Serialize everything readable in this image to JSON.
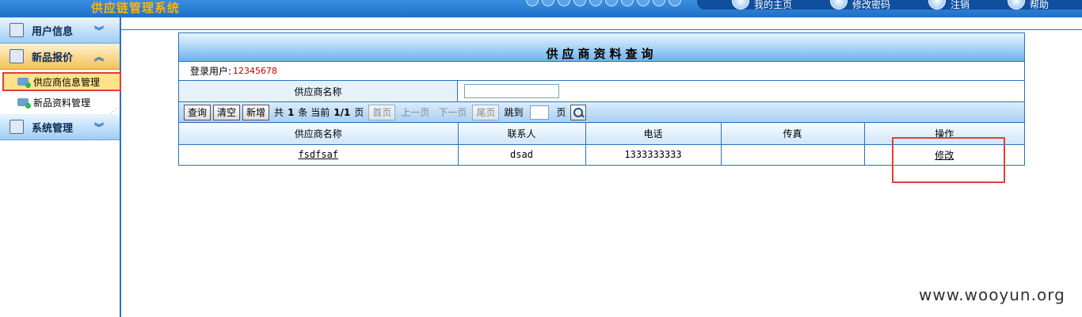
{
  "header": {
    "app_title": "供应链管理系统",
    "toolbar": [
      "我的主页",
      "修改密码",
      "注销",
      "帮助"
    ]
  },
  "sidebar": {
    "groups": [
      {
        "label": "用户信息",
        "expanded": false
      },
      {
        "label": "新品报价",
        "expanded": true,
        "items": [
          "供应商信息管理",
          "新品资料管理"
        ]
      },
      {
        "label": "系统管理",
        "expanded": false
      }
    ]
  },
  "panel": {
    "title": "供应商资料查询",
    "user_label": "登录用户:",
    "user_id": "12345678",
    "filter_label": "供应商名称",
    "filter_value": "",
    "buttons": {
      "query": "查询",
      "clear": "清空",
      "add": "新增"
    },
    "pager": {
      "total_prefix": "共",
      "total": "1",
      "total_suffix": "条",
      "current_prefix": "当前",
      "current": "1/1",
      "current_suffix": "页",
      "first": "首页",
      "prev": "上一页",
      "next": "下一页",
      "last": "尾页",
      "jump_label": "跳到",
      "jump_suffix": "页"
    },
    "columns": [
      "供应商名称",
      "联系人",
      "电话",
      "传真",
      "操作"
    ],
    "rows": [
      {
        "name": "fsdfsaf",
        "contact": "dsad",
        "phone": "1333333333",
        "fax": "",
        "action": "修改"
      }
    ]
  },
  "watermark": "www.wooyun.org",
  "colors": {
    "accent": "#2c6fc0",
    "highlight": "#e53b3b",
    "title_orange": "#ffb400"
  }
}
